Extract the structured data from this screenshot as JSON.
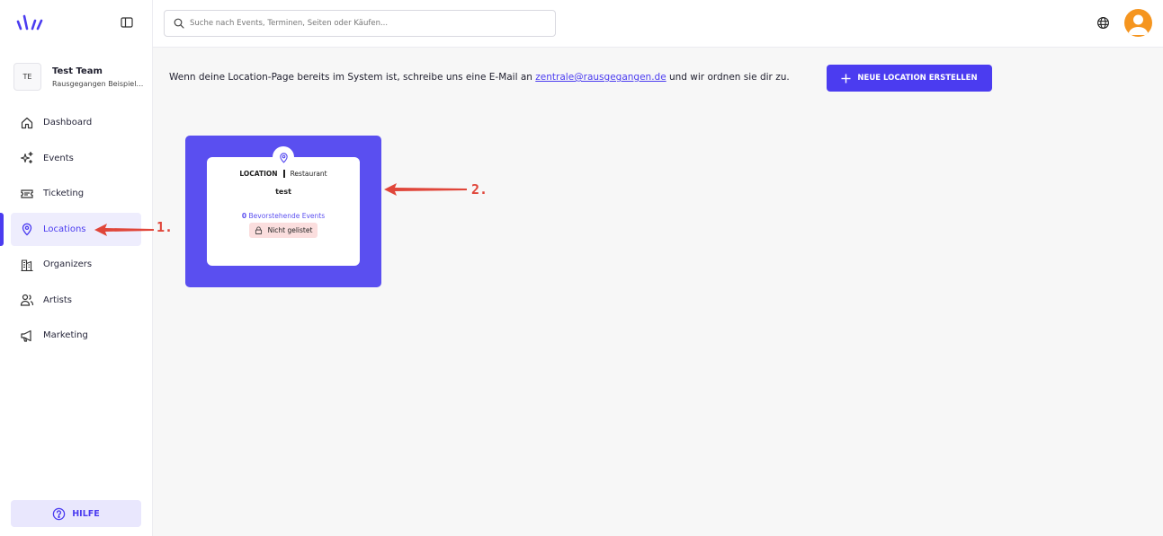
{
  "team": {
    "initials": "TE",
    "name": "Test Team",
    "subtitle": "Rausgegangen Beispiel…"
  },
  "nav": {
    "items": [
      {
        "label": "Dashboard",
        "icon": "home-icon"
      },
      {
        "label": "Events",
        "icon": "sparkles-icon"
      },
      {
        "label": "Ticketing",
        "icon": "ticket-icon"
      },
      {
        "label": "Locations",
        "icon": "map-pin-icon",
        "active": true
      },
      {
        "label": "Organizers",
        "icon": "buildings-icon"
      },
      {
        "label": "Artists",
        "icon": "users-icon"
      },
      {
        "label": "Marketing",
        "icon": "megaphone-icon"
      }
    ]
  },
  "help": {
    "label": "HILFE"
  },
  "search": {
    "placeholder": "Suche nach Events, Terminen, Seiten oder Käufen..."
  },
  "main": {
    "info_prefix": "Wenn deine Location-Page bereits im System ist, schreibe uns eine E-Mail an ",
    "info_email": "zentrale@rausgegangen.de",
    "info_suffix": " und wir ordnen sie dir zu.",
    "new_button": "NEUE LOCATION ERSTELLEN"
  },
  "card": {
    "type": "LOCATION",
    "category": "Restaurant",
    "title": "test",
    "events_count": "0",
    "events_label": " Bevorstehende Events",
    "badge": "Nicht gelistet"
  },
  "annotations": {
    "one": "1.",
    "two": "2."
  },
  "colors": {
    "accent": "#4b3cf0",
    "card_bg": "#5a4ff0",
    "annotation": "#e0463a",
    "badge_bg": "#fbdede",
    "avatar": "#f5951f"
  }
}
